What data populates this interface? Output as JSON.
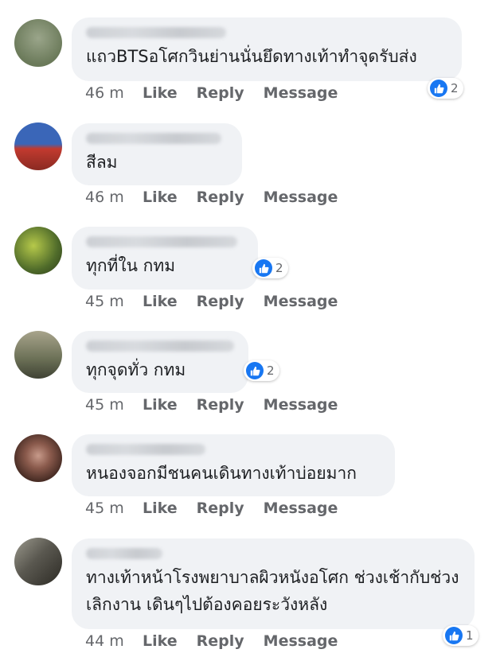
{
  "comments": [
    {
      "author": "Thanatorn Moraeri",
      "text": "แถวBTSอโศกวินย่านนั่นยึดทางเท้าทำจุดรับส่ง",
      "time": "46 m",
      "reactions": "2",
      "avatar_colors": [
        "#6b7a5a",
        "#9aa58a"
      ]
    },
    {
      "author": "Supawan Kanoebo",
      "text": "สีลม",
      "time": "46 m",
      "reactions": "",
      "avatar_colors": [
        "#3a66b8",
        "#c23a2f"
      ]
    },
    {
      "author": "Songporn Bangsawat",
      "text": "ทุกที่ใน กทม",
      "time": "45 m",
      "reactions": "2",
      "avatar_colors": [
        "#4f6b2a",
        "#b6c94a"
      ]
    },
    {
      "author": "Komsan Tiantantuk",
      "text": "ทุกจุดทั่ว กทม",
      "time": "45 m",
      "reactions": "2",
      "avatar_colors": [
        "#6a6f55",
        "#a8a48c"
      ]
    },
    {
      "author": "Pamornsaan Thai",
      "text": "หนองจอกมีชนคนเดินทางเท้าบ่อยมาก",
      "time": "45 m",
      "reactions": "",
      "avatar_colors": [
        "#4a2e26",
        "#c79a8a"
      ]
    },
    {
      "author": "อารีดา พลาน",
      "text": "ทางเท้าหน้าโรงพยาบาลผิวหนังอโศก ช่วงเช้ากับช่วงเลิกงาน เดินๆไปต้องคอยระวังหลัง",
      "time": "44 m",
      "reactions": "1",
      "avatar_colors": [
        "#2c2a24",
        "#9c9a8e"
      ]
    }
  ],
  "labels": {
    "like": "Like",
    "reply": "Reply",
    "message": "Message"
  },
  "colors": {
    "like_blue": "#1877f2",
    "bubble_bg": "#f0f2f5",
    "meta_gray": "#65676b"
  }
}
